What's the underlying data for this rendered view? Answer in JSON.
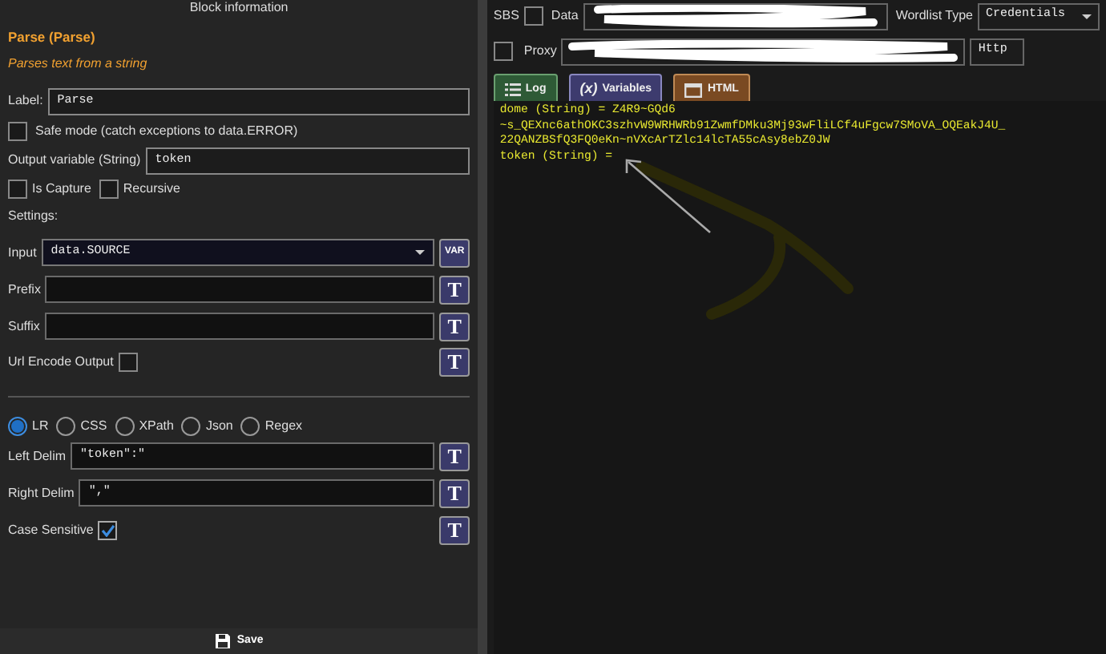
{
  "header": {
    "title": "Block information"
  },
  "block": {
    "name": "Parse (Parse)",
    "description": "Parses text from a string"
  },
  "label_field": {
    "label": "Label:",
    "value": "Parse"
  },
  "safe_mode": {
    "label": "Safe mode (catch exceptions to data.ERROR)",
    "checked": false
  },
  "output_variable": {
    "label": "Output variable (String)",
    "value": "token"
  },
  "options": [
    {
      "label": "Is Capture",
      "checked": false
    },
    {
      "label": "Recursive",
      "checked": false
    }
  ],
  "settings_label": "Settings:",
  "settings": [
    {
      "kind": "select",
      "label": "Input",
      "value": "data.SOURCE",
      "button": "VAR"
    },
    {
      "kind": "text",
      "label": "Prefix",
      "button": "T"
    },
    {
      "kind": "text",
      "label": "Suffix",
      "button": "T"
    },
    {
      "kind": "checkbox",
      "label": "Url Encode Output",
      "checked": false,
      "button": "T"
    }
  ],
  "modes": [
    {
      "label": "LR",
      "selected": true
    },
    {
      "label": "CSS",
      "selected": false
    },
    {
      "label": "XPath",
      "selected": false
    },
    {
      "label": "Json",
      "selected": false
    },
    {
      "label": "Regex",
      "selected": false
    }
  ],
  "mode_settings": [
    {
      "kind": "text",
      "label": "Left Delim",
      "value": "\"token\":\"",
      "button": "T"
    },
    {
      "kind": "text",
      "label": "Right Delim",
      "value": "\",\"",
      "button": "T"
    },
    {
      "kind": "checkbox",
      "label": "Case Sensitive",
      "checked": true,
      "button": "T"
    }
  ],
  "save_button": "Save",
  "top_bar": {
    "sbs": {
      "label": "SBS",
      "checked": false
    },
    "data_label": "Data",
    "wordlist_label": "Wordlist Type",
    "wordlist_value": "Credentials",
    "proxy": {
      "label": "Proxy",
      "checked": false
    },
    "proxy_type": "Http"
  },
  "tabs": [
    {
      "kind": "log",
      "label": "Log"
    },
    {
      "kind": "variables",
      "icon_text": "(x)",
      "label": "Variables"
    },
    {
      "kind": "html",
      "label": "HTML"
    }
  ],
  "output_lines": [
    "dome (String) = Z4R9~GQd6",
    "~s_QEXnc6athOKC3szhvW9WRHWRb91ZwmfDMku3Mj93wFliLCf4uFgcw7SMoVA_OQEakJ4U_",
    "22QANZBSfQ3FQ0eKn~nVXcArTZlc14lcTA55cAsy8ebZ0JW",
    "token (String) ="
  ]
}
